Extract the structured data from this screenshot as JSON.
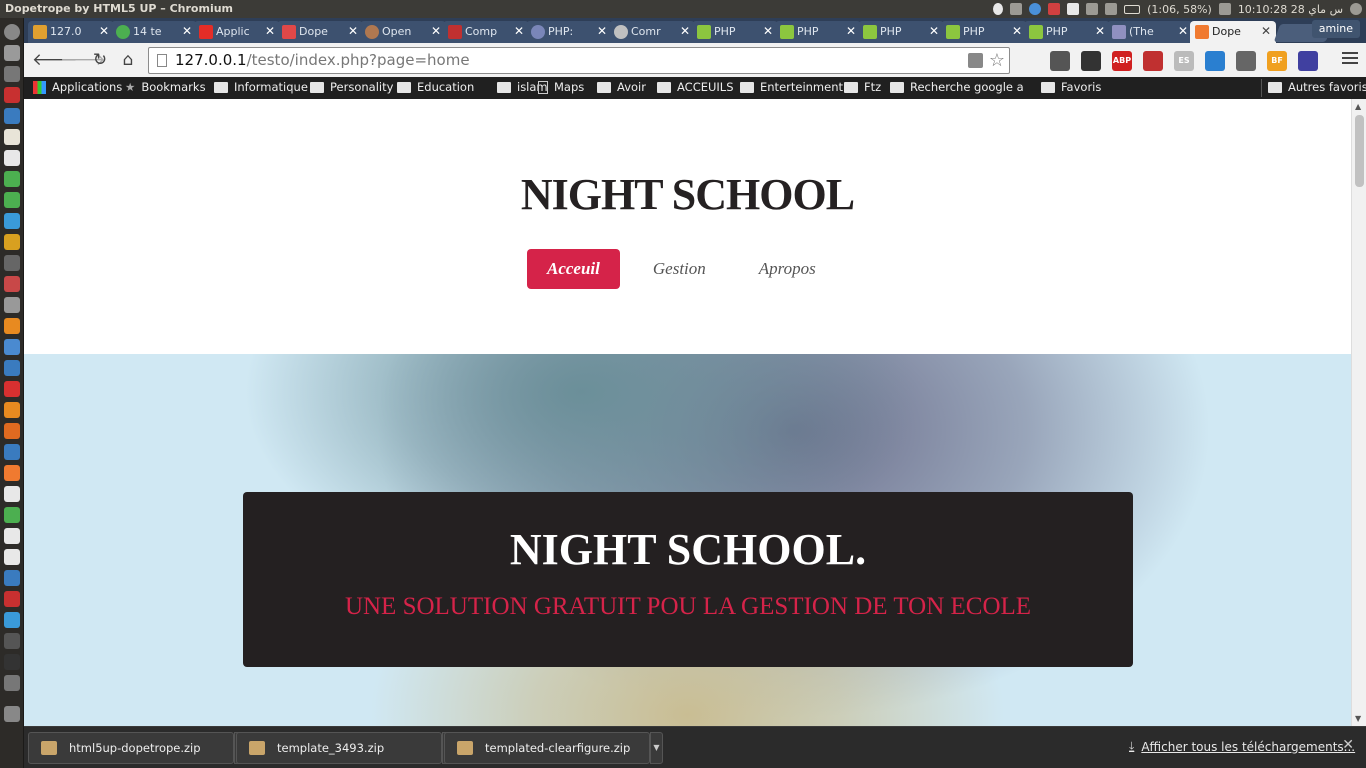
{
  "os": {
    "window_title": "Dopetrope by HTML5 UP – Chromium",
    "battery": "(1:06, 58%)",
    "clock": "10:10:28 28 س ماي"
  },
  "browser": {
    "tabs": [
      {
        "label": "127.0",
        "favicon_color": "#e0a030"
      },
      {
        "label": "14 te",
        "favicon_color": "#4caf50"
      },
      {
        "label": "Applic",
        "favicon_color": "#e52d27"
      },
      {
        "label": "Dope",
        "favicon_color": "#e04848"
      },
      {
        "label": "Open",
        "favicon_color": "#b07850"
      },
      {
        "label": "Comp",
        "favicon_color": "#c03030"
      },
      {
        "label": "PHP:",
        "favicon_color": "#7a86b8"
      },
      {
        "label": "Comr",
        "favicon_color": "#c0c0c0"
      },
      {
        "label": "PHP",
        "favicon_color": "#8cc63f"
      },
      {
        "label": "PHP",
        "favicon_color": "#8cc63f"
      },
      {
        "label": "PHP",
        "favicon_color": "#8cc63f"
      },
      {
        "label": "PHP",
        "favicon_color": "#8cc63f"
      },
      {
        "label": "PHP",
        "favicon_color": "#8cc63f"
      },
      {
        "label": "(The",
        "favicon_color": "#9090c0"
      },
      {
        "label": "Dope",
        "favicon_color": "#f07a30",
        "active": true
      }
    ],
    "user": "amine",
    "url_host": "127.0.0.1",
    "url_path": "/testo/index.php?page=home",
    "extensions": [
      {
        "name": "evernote-icon",
        "label": "",
        "color": "#555555"
      },
      {
        "name": "spy-icon",
        "label": "",
        "color": "#333333"
      },
      {
        "name": "adblock-icon",
        "label": "ABP",
        "color": "#d02020"
      },
      {
        "name": "pocket-icon",
        "label": "",
        "color": "#c03030"
      },
      {
        "name": "es-icon",
        "label": "ES",
        "color": "#bbbbbb"
      },
      {
        "name": "dropbox-icon",
        "label": "",
        "color": "#2a7fd0"
      },
      {
        "name": "mcafee-icon",
        "label": "",
        "color": "#666666"
      },
      {
        "name": "bf-icon",
        "label": "BF",
        "color": "#f0a020"
      },
      {
        "name": "speed-icon",
        "label": "",
        "color": "#4040a0"
      }
    ],
    "bookmarks": [
      {
        "label": "Applications",
        "icon": "apps-grid-icon"
      },
      {
        "label": "Bookmarks",
        "icon": "star-icon"
      },
      {
        "label": "Informatique",
        "icon": "folder-icon"
      },
      {
        "label": "Personality",
        "icon": "folder-icon"
      },
      {
        "label": "Education",
        "icon": "folder-icon"
      },
      {
        "label": "islam",
        "icon": "folder-icon"
      },
      {
        "label": "Maps",
        "icon": "page-icon"
      },
      {
        "label": "Avoir",
        "icon": "folder-icon"
      },
      {
        "label": "ACCEUILS",
        "icon": "folder-icon"
      },
      {
        "label": "Enterteinment",
        "icon": "folder-icon"
      },
      {
        "label": "Ftz",
        "icon": "folder-icon"
      },
      {
        "label": "Recherche google a tr",
        "icon": "folder-icon"
      },
      {
        "label": "Favoris",
        "icon": "folder-icon"
      }
    ],
    "other_bookmarks": "Autres favoris"
  },
  "site": {
    "title": "NIGHT SCHOOL",
    "nav": [
      {
        "label": "Acceuil",
        "current": true
      },
      {
        "label": "Gestion"
      },
      {
        "label": "Apropos"
      }
    ],
    "banner_title": "NIGHT SCHOOL.",
    "banner_subtitle": "UNE SOLUTION GRATUIT POU LA GESTION DE TON ECOLE",
    "accent_color": "#d52349"
  },
  "downloads": {
    "items": [
      {
        "name": "html5up-dopetrope.zip"
      },
      {
        "name": "template_3493.zip"
      },
      {
        "name": "templated-clearfigure.zip"
      }
    ],
    "show_all": "Afficher tous les téléchargements..."
  }
}
